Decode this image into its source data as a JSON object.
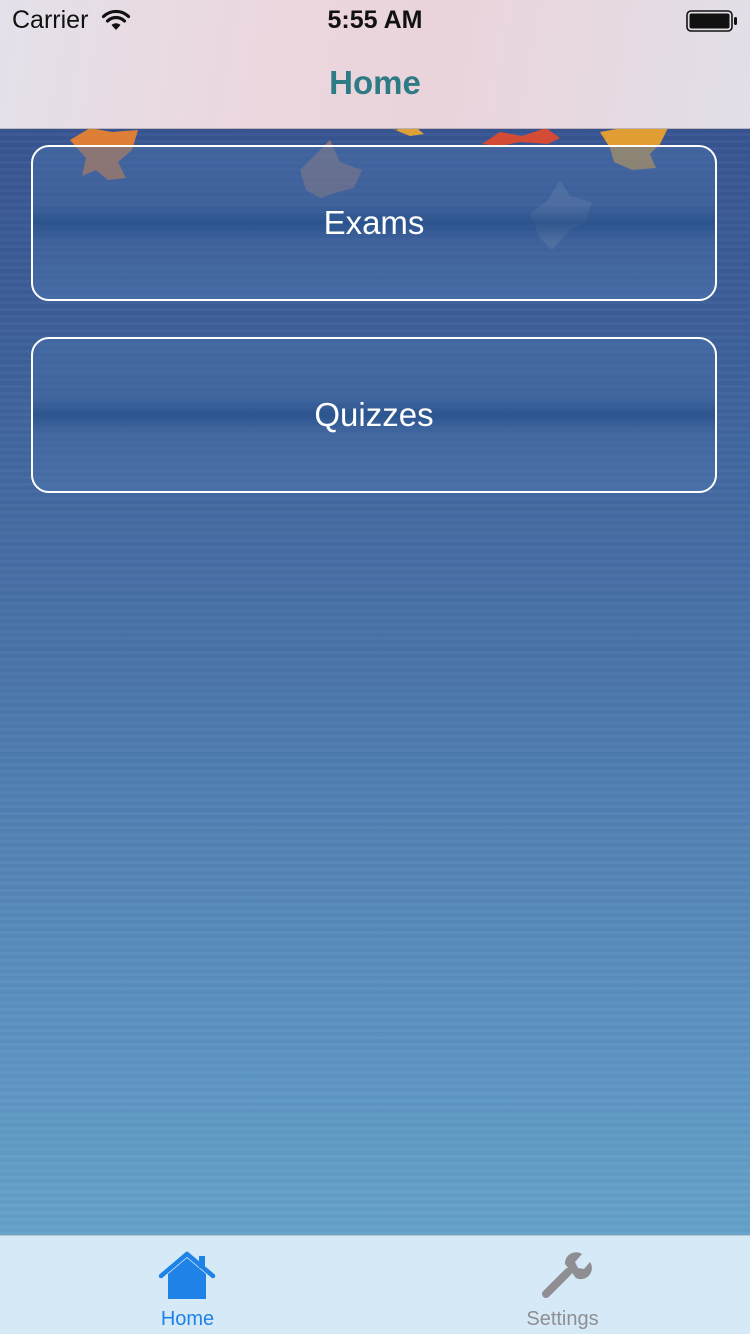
{
  "status_bar": {
    "carrier": "Carrier",
    "time": "5:55 AM",
    "wifi_icon": "wifi-icon",
    "battery_icon": "battery-full-icon"
  },
  "nav": {
    "title": "Home"
  },
  "menu": {
    "items": [
      {
        "label": "Exams"
      },
      {
        "label": "Quizzes"
      }
    ]
  },
  "tab_bar": {
    "items": [
      {
        "label": "Home",
        "icon": "home-icon",
        "selected": true
      },
      {
        "label": "Settings",
        "icon": "wrench-icon",
        "selected": false
      }
    ]
  },
  "colors": {
    "nav_title": "#2d7b84",
    "tab_selected": "#1e82e6",
    "tab_unselected": "#8e8e93",
    "button_border": "#ffffff"
  }
}
